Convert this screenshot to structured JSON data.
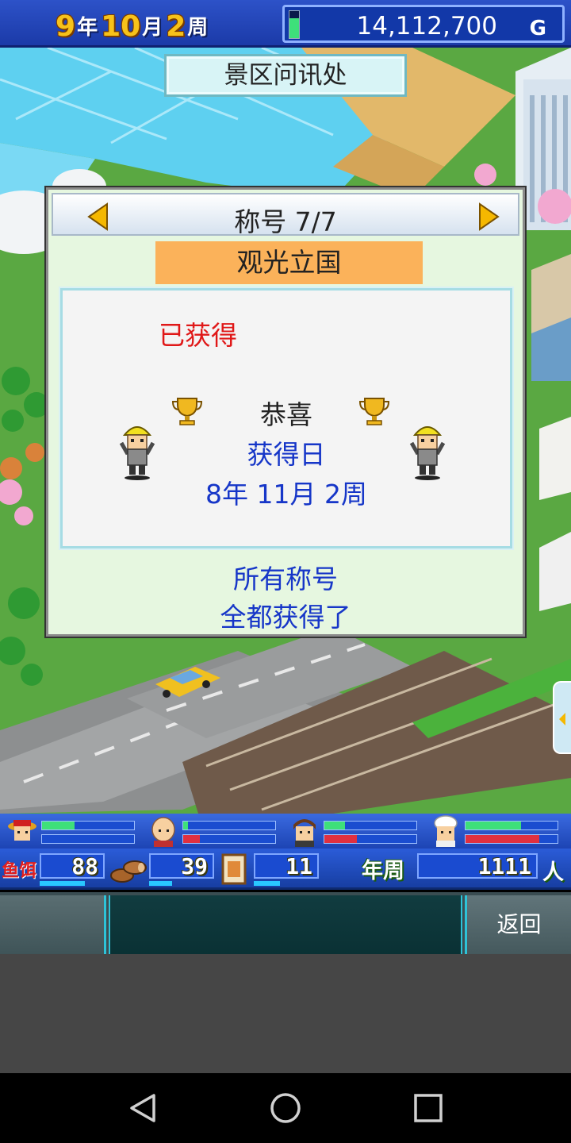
{
  "header": {
    "year": "9",
    "year_unit": "年",
    "month": "10",
    "month_unit": "月",
    "week": "2",
    "week_unit": "周",
    "money": "14,112,700",
    "money_unit": "G",
    "money_gauge_level": 0.75
  },
  "location_label": "景区问讯处",
  "dialog": {
    "title": "称号 7/7",
    "award_name": "观光立国",
    "status": "已获得",
    "congrats": "恭喜",
    "date_label": "获得日",
    "date_value": "8年 11月 2周",
    "footer_line1": "所有称号",
    "footer_line2": "全都获得了",
    "icons": {
      "prev": "triangle-left-icon",
      "next": "triangle-right-icon",
      "trophy": "trophy-icon",
      "worker": "construction-worker-icon"
    }
  },
  "staff": [
    {
      "icon": "staff-hat-icon",
      "bar1": 0.35,
      "bar2": 0.0
    },
    {
      "icon": "staff-bald-icon",
      "bar1": 0.05,
      "bar2": 0.18
    },
    {
      "icon": "staff-brown-hair-icon",
      "bar1": 0.22,
      "bar2": 0.35
    },
    {
      "icon": "staff-chef-icon",
      "bar1": 0.6,
      "bar2": 0.8
    }
  ],
  "resources": {
    "food_label": "鱼饵",
    "food_value": "88",
    "wood_value": "39",
    "board_value": "11",
    "year_week_label": "年周",
    "population_value": "1111",
    "population_unit": "人"
  },
  "menu": {
    "back_label": "返回"
  },
  "colors": {
    "accent_blue": "#1636c8",
    "obtained_red": "#e01818",
    "ribbon_orange": "#fbb25a",
    "topbar_blue": "#2d52c8"
  }
}
